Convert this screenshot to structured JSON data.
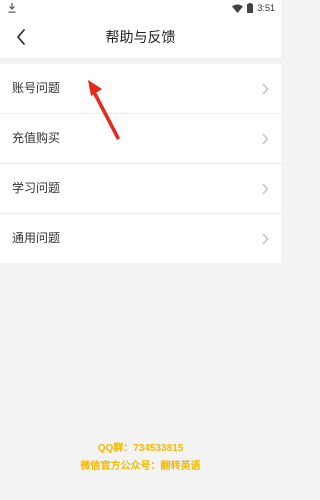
{
  "status_bar": {
    "time": "3:51",
    "icons": [
      "download-icon",
      "wifi-icon",
      "battery-icon"
    ]
  },
  "header": {
    "title": "帮助与反馈",
    "back_icon": "chevron-left-icon"
  },
  "menu": {
    "items": [
      {
        "label": "账号问题"
      },
      {
        "label": "充值购买"
      },
      {
        "label": "学习问题"
      },
      {
        "label": "通用问题"
      }
    ]
  },
  "footer": {
    "qq_group": "QQ群：734533815",
    "wechat": "微信官方公众号：翻转英语"
  },
  "colors": {
    "accent": "#f5b800",
    "annotation": "#e8281c",
    "background": "#f3f3f3"
  }
}
